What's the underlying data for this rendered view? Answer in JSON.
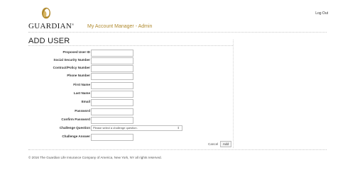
{
  "header": {
    "logout_label": "Log Out",
    "brand_name": "GUARDIAN",
    "brand_mark": "®",
    "app_title": "My Account Manager - Admin",
    "accent_color": "#b08a2e"
  },
  "page": {
    "title": "ADD USER"
  },
  "form": {
    "fields": [
      {
        "label": "Proposed User ID",
        "value": ""
      },
      {
        "label": "Social Security Number",
        "value": ""
      },
      {
        "label": "Contract/Policy Number",
        "value": ""
      },
      {
        "label": "Phone Number",
        "value": ""
      },
      {
        "label": "First Name",
        "value": ""
      },
      {
        "label": "Last Name",
        "value": ""
      },
      {
        "label": "Email",
        "value": ""
      },
      {
        "label": "Password",
        "value": ""
      },
      {
        "label": "Confirm Password",
        "value": ""
      }
    ],
    "challenge_question": {
      "label": "Challenge Question",
      "selected": "Please select a challenge question."
    },
    "challenge_answer": {
      "label": "Challenge Answer",
      "value": ""
    },
    "cancel_label": "Cancel",
    "add_label": "Add"
  },
  "footer": {
    "copyright": "© 2016 The Guardian Life Insurance Company of America, New York, NY all rights reserved."
  },
  "icons": {
    "logo": "guardian-flame-logo",
    "select_arrow": "updown-arrow-icon"
  }
}
